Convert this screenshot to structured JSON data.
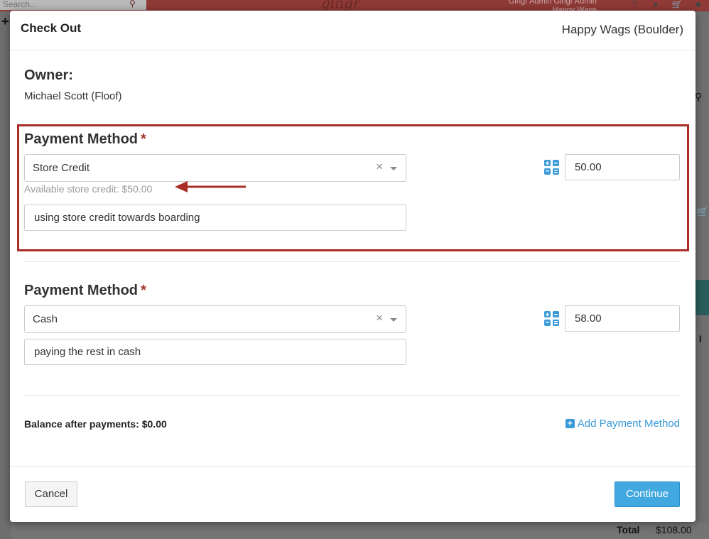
{
  "background": {
    "search_placeholder": "Search...",
    "logo": "gingr",
    "user_line1": "Gingr Admin Gingr Admin",
    "user_line2": "Happy Wags",
    "total_label": "Total",
    "total_value": "$108.00"
  },
  "modal": {
    "title": "Check Out",
    "location": "Happy Wags (Boulder)"
  },
  "owner": {
    "label": "Owner:",
    "name": "Michael Scott (Floof)"
  },
  "payments": [
    {
      "label": "Payment Method",
      "required_mark": "*",
      "method": "Store Credit",
      "help_text": "Available store credit: $50.00",
      "note": "using store credit towards boarding",
      "amount": "50.00"
    },
    {
      "label": "Payment Method",
      "required_mark": "*",
      "method": "Cash",
      "note": "paying the rest in cash",
      "amount": "58.00"
    }
  ],
  "balance": {
    "text": "Balance after payments: $0.00"
  },
  "actions": {
    "add_payment_method": "Add Payment Method",
    "cancel": "Cancel",
    "continue": "Continue"
  },
  "colors": {
    "highlight": "#a92d25",
    "accent": "#42a9e0",
    "link": "#3a9ad9",
    "required": "#a5332c"
  },
  "icons": {
    "calculator": "calculator-icon",
    "clear": "clear-icon",
    "dropdown": "chevron-down-icon",
    "plus": "plus-square-icon",
    "arrow": "arrow-left-icon"
  }
}
